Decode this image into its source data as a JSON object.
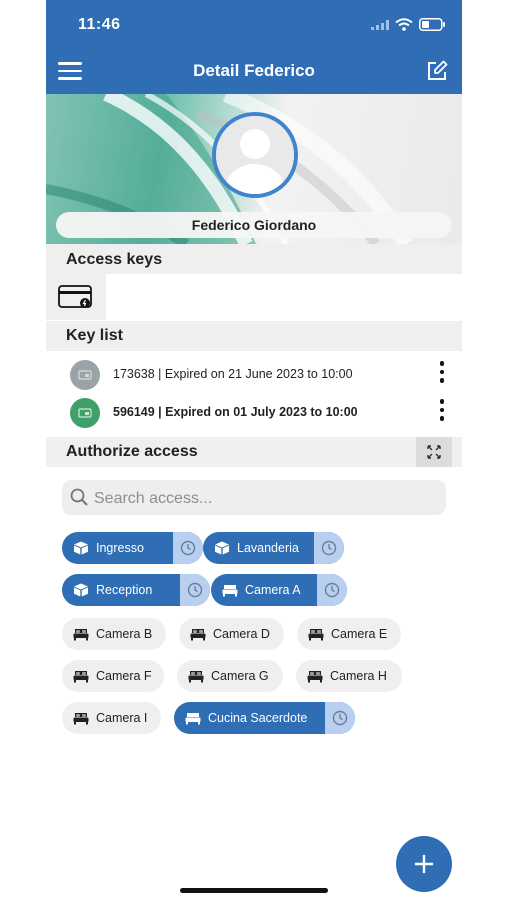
{
  "status": {
    "time": "11:46"
  },
  "nav": {
    "title": "Detail Federico"
  },
  "profile": {
    "name": "Federico Giordano"
  },
  "access_keys": {
    "title": "Access keys"
  },
  "key_list": {
    "title": "Key list",
    "items": [
      {
        "text": "173638 | Expired on 21 June 2023 to 10:00",
        "color": "#9aa3a6",
        "bold": false
      },
      {
        "text": "596149 | Expired on 01 July 2023 to 10:00",
        "color": "#3fa06a",
        "bold": true
      }
    ]
  },
  "authorize": {
    "title": "Authorize access",
    "search_placeholder": "Search access..."
  },
  "chips": [
    {
      "label": "Ingresso",
      "active": true,
      "icon": "cube-icon"
    },
    {
      "label": "Lavanderia",
      "active": true,
      "icon": "cube-icon"
    },
    {
      "label": "Reception",
      "active": true,
      "icon": "cube-icon"
    },
    {
      "label": "Camera A",
      "active": true,
      "icon": "bed-icon"
    },
    {
      "label": "Camera B",
      "active": false,
      "icon": "bed-icon"
    },
    {
      "label": "Camera D",
      "active": false,
      "icon": "bed-icon"
    },
    {
      "label": "Camera E",
      "active": false,
      "icon": "bed-icon"
    },
    {
      "label": "Camera F",
      "active": false,
      "icon": "bed-icon"
    },
    {
      "label": "Camera G",
      "active": false,
      "icon": "bed-icon"
    },
    {
      "label": "Camera H",
      "active": false,
      "icon": "bed-icon"
    },
    {
      "label": "Camera I",
      "active": false,
      "icon": "bed-icon"
    },
    {
      "label": "Cucina Sacerdote",
      "active": true,
      "icon": "bed-icon"
    }
  ],
  "colors": {
    "primary": "#2f6db5",
    "clock_bg": "#b9cff0",
    "chip_off": "#efefef"
  }
}
